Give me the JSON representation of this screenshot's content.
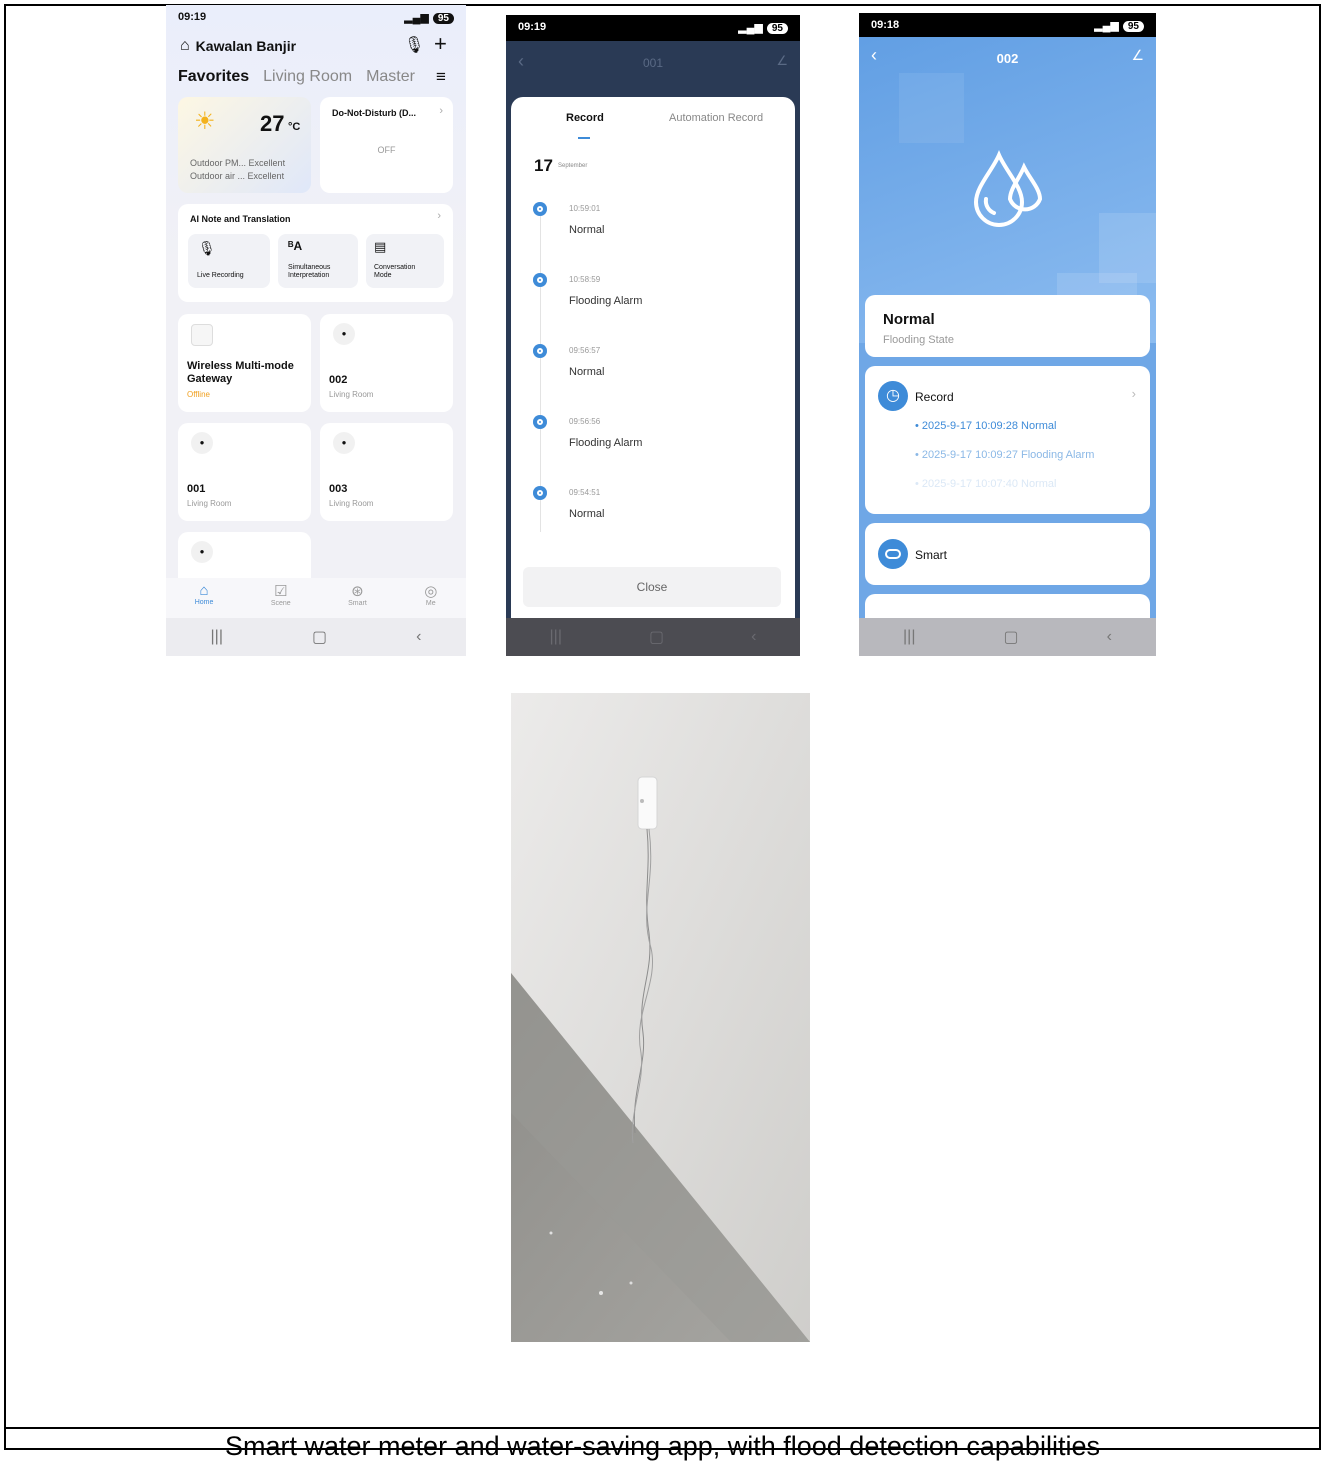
{
  "caption": "Smart water meter and water-saving app, with flood detection capabilities",
  "phone1": {
    "status_time": "09:19",
    "battery": "95",
    "home_name": "Kawalan Banjir",
    "tabs": [
      "Favorites",
      "Living Room",
      "Master"
    ],
    "weather": {
      "temp": "27",
      "unit": "°C",
      "pm_label": "Outdoor PM...",
      "pm_value": "Excellent",
      "air_label": "Outdoor air ...",
      "air_value": "Excellent"
    },
    "dnd": {
      "title": "Do-Not-Disturb (D...",
      "state": "OFF"
    },
    "ai": {
      "title": "AI Note and Translation",
      "items": [
        "Live Recording",
        "Simultaneous Interpretation",
        "Conversation Mode"
      ]
    },
    "devices": [
      {
        "name": "Wireless Multi-mode Gateway",
        "sub": "Offline"
      },
      {
        "name": "002",
        "sub": "Living Room"
      },
      {
        "name": "001",
        "sub": "Living Room"
      },
      {
        "name": "003",
        "sub": "Living Room"
      }
    ],
    "bottom_nav": [
      "Home",
      "Scene",
      "Smart",
      "Me"
    ]
  },
  "phone2": {
    "status_time": "09:19",
    "battery": "95",
    "title": "001",
    "tabs": [
      "Record",
      "Automation Record"
    ],
    "date_day": "17",
    "date_month": "September",
    "records": [
      {
        "time": "10:59:01",
        "state": "Normal"
      },
      {
        "time": "10:58:59",
        "state": "Flooding Alarm"
      },
      {
        "time": "09:56:57",
        "state": "Normal"
      },
      {
        "time": "09:56:56",
        "state": "Flooding Alarm"
      },
      {
        "time": "09:54:51",
        "state": "Normal"
      }
    ],
    "close": "Close"
  },
  "phone3": {
    "status_time": "09:18",
    "battery": "95",
    "title": "002",
    "state": "Normal",
    "state_label": "Flooding State",
    "record_title": "Record",
    "records": [
      "2025-9-17 10:09:28 Normal",
      "2025-9-17 10:09:27 Flooding Alarm",
      "2025-9-17 10:07:40 Normal"
    ],
    "smart": "Smart"
  },
  "colors": {
    "accent": "#3e8bd8",
    "offline": "#f0a020",
    "dark_header": "#2a3a55"
  }
}
